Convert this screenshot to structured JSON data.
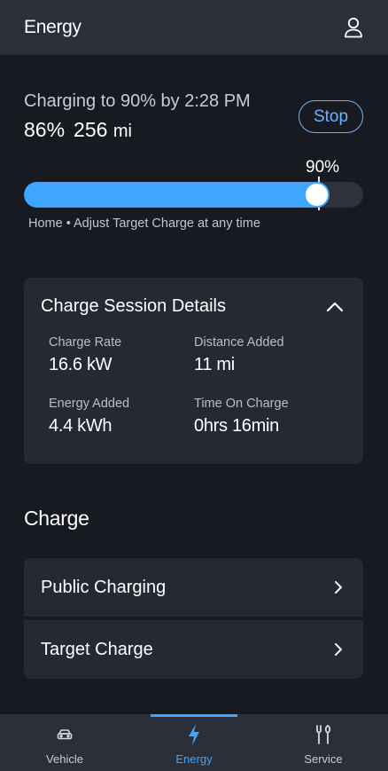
{
  "header": {
    "title": "Energy",
    "profile_icon": "person-icon"
  },
  "charging": {
    "status": "Charging to 90% by 2:28 PM",
    "battery_percent": "86%",
    "range_value": "256",
    "range_unit": "mi",
    "stop_label": "Stop",
    "target_label": "90%",
    "current_level": 0.86,
    "target_level": 0.9,
    "hint": "Home • Adjust Target Charge at any time"
  },
  "session": {
    "title": "Charge Session Details",
    "charge_rate_label": "Charge Rate",
    "charge_rate_value": "16.6 kW",
    "distance_label": "Distance Added",
    "distance_value": "11 mi",
    "energy_label": "Energy Added",
    "energy_value": "4.4 kWh",
    "time_label": "Time On Charge",
    "time_value": "0hrs 16min"
  },
  "charge_section": {
    "title": "Charge",
    "items": [
      {
        "label": "Public Charging"
      },
      {
        "label": "Target Charge"
      }
    ]
  },
  "nav": {
    "active": "Energy",
    "items": [
      {
        "label": "Vehicle",
        "icon": "car-icon"
      },
      {
        "label": "Energy",
        "icon": "lightning-bolt-icon"
      },
      {
        "label": "Service",
        "icon": "tools-icon"
      }
    ]
  },
  "colors": {
    "accent": "#3ea6ff",
    "background": "#171a21",
    "card": "#252933",
    "bar": "#2b2f3a"
  }
}
